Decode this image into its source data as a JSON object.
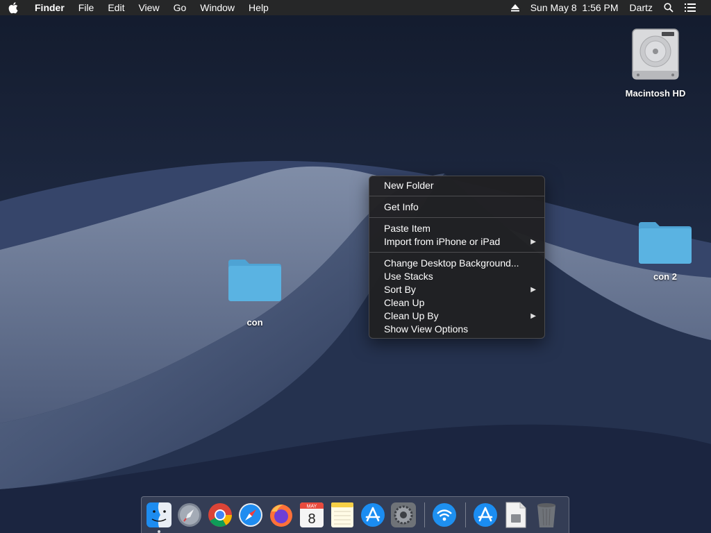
{
  "menubar": {
    "app_name": "Finder",
    "menus": [
      "File",
      "Edit",
      "View",
      "Go",
      "Window",
      "Help"
    ],
    "datetime": "Sun May 8  1:56 PM",
    "user": "Dartz",
    "icons": [
      "apple-icon",
      "eject-icon",
      "search-icon",
      "list-icon"
    ]
  },
  "desktop": {
    "items": [
      {
        "label": "Macintosh HD",
        "icon": "hard-drive-icon"
      },
      {
        "label": "con 2",
        "icon": "folder-icon"
      },
      {
        "label": "con",
        "icon": "folder-icon"
      }
    ]
  },
  "context_menu": {
    "groups": [
      [
        "New Folder"
      ],
      [
        "Get Info"
      ],
      [
        "Paste Item",
        "Import from iPhone or iPad"
      ],
      [
        "Change Desktop Background...",
        "Use Stacks",
        "Sort By",
        "Clean Up",
        "Clean Up By",
        "Show View Options"
      ]
    ],
    "new_folder": "New Folder",
    "get_info": "Get Info",
    "paste_item": "Paste Item",
    "import_iphone": "Import from iPhone or iPad",
    "change_bg": "Change Desktop Background...",
    "use_stacks": "Use Stacks",
    "sort_by": "Sort By",
    "clean_up": "Clean Up",
    "clean_up_by": "Clean Up By",
    "show_view_options": "Show View Options"
  },
  "dock": {
    "apps": [
      "finder-icon",
      "launchpad-icon",
      "chrome-icon",
      "safari-icon",
      "firefox-icon",
      "calendar-icon",
      "notes-icon",
      "app-store-icon",
      "system-preferences-icon",
      "wifi-diagnostics-icon",
      "app-store-download-icon",
      "installer-doc-icon",
      "trash-icon"
    ],
    "calendar_month": "MAY",
    "calendar_day": "8"
  },
  "colors": {
    "menubar_bg": "#282828",
    "folder_blue": "#5ab3e2",
    "menu_bg": "#202022"
  }
}
